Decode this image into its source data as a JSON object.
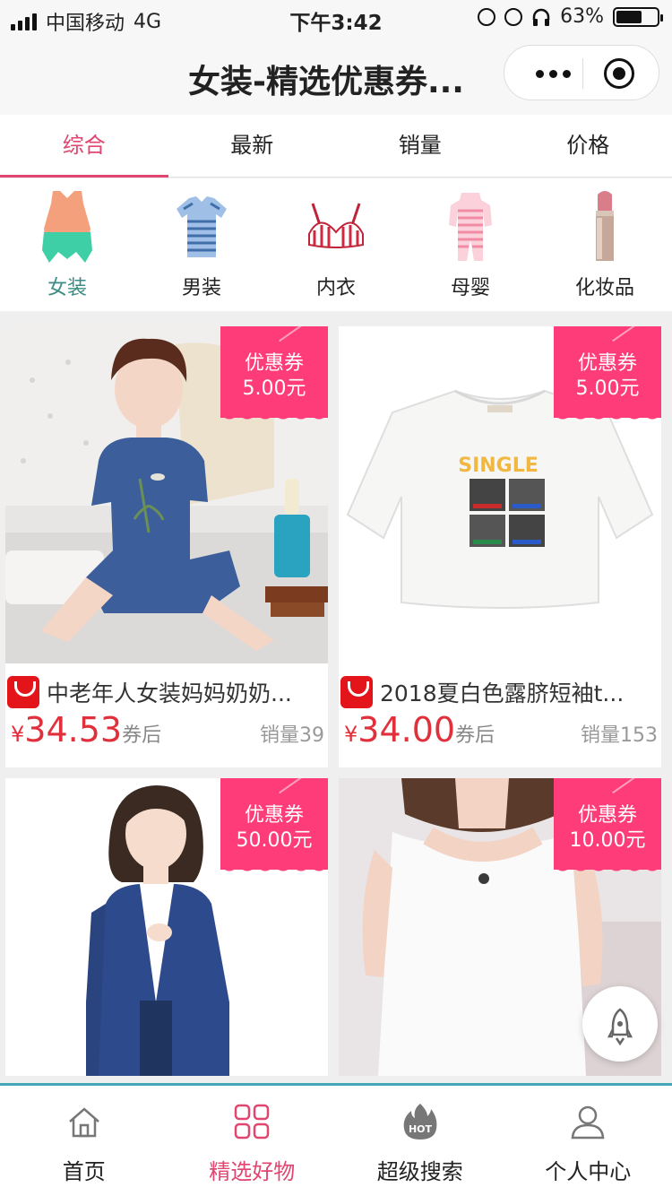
{
  "status_bar": {
    "carrier": "中国移动",
    "network": "4G",
    "time": "下午3:42",
    "battery_percent": "63%",
    "battery_level": 0.63,
    "icons": [
      "signal-icon",
      "lock-rotation-icon",
      "alarm-icon",
      "headphones-icon",
      "battery-icon"
    ]
  },
  "navbar": {
    "title": "女装-精选优惠券...",
    "more_icon": "more-dots-icon",
    "close_icon": "target-circle-icon"
  },
  "sort_tabs": [
    {
      "label": "综合",
      "active": true
    },
    {
      "label": "最新",
      "active": false
    },
    {
      "label": "销量",
      "active": false
    },
    {
      "label": "价格",
      "active": false
    }
  ],
  "categories": [
    {
      "label": "女装",
      "icon": "womens-top-icon",
      "active": true
    },
    {
      "label": "男装",
      "icon": "mens-tshirt-icon",
      "active": false
    },
    {
      "label": "内衣",
      "icon": "bra-icon",
      "active": false
    },
    {
      "label": "母婴",
      "icon": "baby-onesie-icon",
      "active": false
    },
    {
      "label": "化妆品",
      "icon": "lipstick-icon",
      "active": false
    }
  ],
  "products": [
    {
      "coupon_label": "优惠券",
      "coupon_value": "5.00元",
      "title": "中老年人女装妈妈奶奶...",
      "yen": "¥",
      "price": "34.53",
      "price_suffix": "券后",
      "sales": "销量39",
      "image": "woman-blue-outfit"
    },
    {
      "coupon_label": "优惠券",
      "coupon_value": "5.00元",
      "title": "2018夏白色露脐短袖t...",
      "yen": "¥",
      "price": "34.00",
      "price_suffix": "券后",
      "sales": "销量153",
      "image": "white-tshirt-single"
    },
    {
      "coupon_label": "优惠券",
      "coupon_value": "50.00元",
      "title": "",
      "image": "woman-blue-cardigan"
    },
    {
      "coupon_label": "优惠券",
      "coupon_value": "10.00元",
      "title": "",
      "image": "white-tank-top"
    }
  ],
  "fab": {
    "icon": "rocket-icon"
  },
  "tabbar": [
    {
      "label": "首页",
      "icon": "home-icon",
      "active": false
    },
    {
      "label": "精选好物",
      "icon": "grid-icon",
      "active": true
    },
    {
      "label": "超级搜索",
      "icon": "hot-fire-icon",
      "active": false
    },
    {
      "label": "个人中心",
      "icon": "user-icon",
      "active": false
    }
  ],
  "colors": {
    "accent": "#e0466f",
    "coupon": "#ff3c7a",
    "price": "#e0303b",
    "category_active": "#3c8c85",
    "tabbar_line": "#43a7b8"
  }
}
